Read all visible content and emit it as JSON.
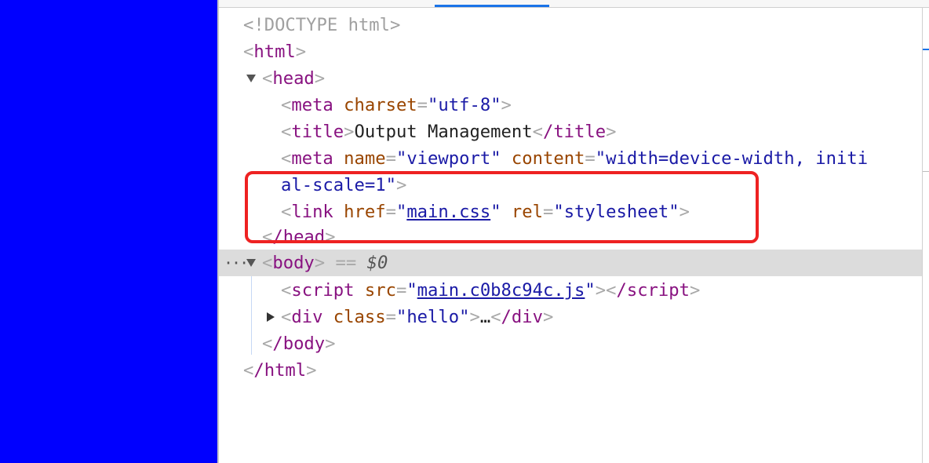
{
  "page": {
    "background_color": "#0000ff"
  },
  "elements_panel": {
    "doctype": "<!DOCTYPE html>",
    "html_open": {
      "tag": "html"
    },
    "head": {
      "tag": "head",
      "meta_charset": {
        "tag": "meta",
        "attr": "charset",
        "value": "utf-8"
      },
      "title": {
        "open": "title",
        "text": "Output Management",
        "close": "/title"
      },
      "meta_viewport": {
        "tag": "meta",
        "attr1": "name",
        "val1": "viewport",
        "attr2": "content",
        "val2_part1": "width=device-width, initi",
        "val2_part2": "al-scale=1"
      },
      "link": {
        "tag": "link",
        "attr1": "href",
        "val1": "main.css",
        "attr2": "rel",
        "val2": "stylesheet"
      },
      "close": "/head"
    },
    "body": {
      "tag": "body",
      "selected_suffix": "== ",
      "selected_var": "$0",
      "ellipsis": "···",
      "script": {
        "tag": "script",
        "attr": "src",
        "value": "main.c0b8c94c.js",
        "close": "/script"
      },
      "div": {
        "tag": "div",
        "attr": "class",
        "value": "hello",
        "ellipsis": "…",
        "close": "/div"
      },
      "close": "/body"
    },
    "html_close": "/html",
    "highlight_color": "#ee2222",
    "selection_color": "#dcdcdc"
  }
}
